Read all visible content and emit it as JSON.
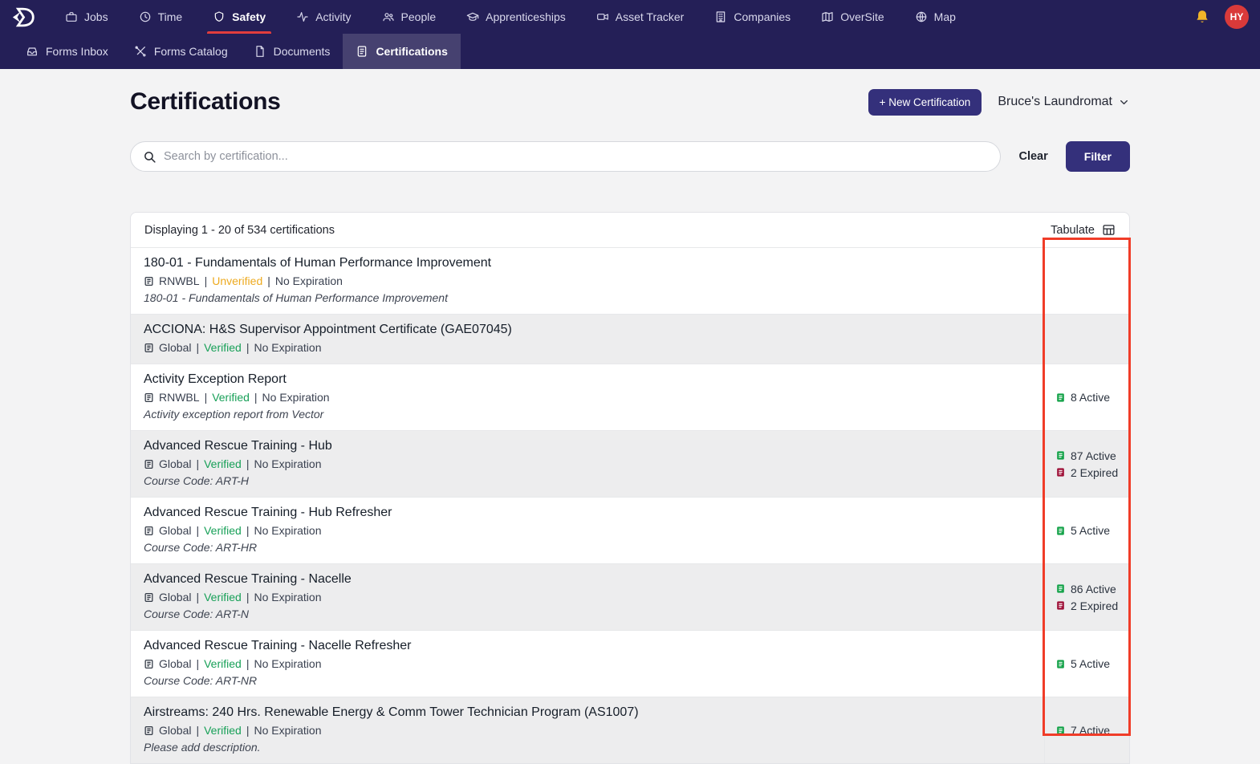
{
  "meta_separator": "|",
  "nav": {
    "avatar": "HY",
    "items": [
      {
        "label": "Jobs"
      },
      {
        "label": "Time"
      },
      {
        "label": "Safety"
      },
      {
        "label": "Activity"
      },
      {
        "label": "People"
      },
      {
        "label": "Apprenticeships"
      },
      {
        "label": "Asset Tracker"
      },
      {
        "label": "Companies"
      },
      {
        "label": "OverSite"
      },
      {
        "label": "Map"
      }
    ]
  },
  "subnav": {
    "items": [
      {
        "label": "Forms Inbox"
      },
      {
        "label": "Forms Catalog"
      },
      {
        "label": "Documents"
      },
      {
        "label": "Certifications"
      }
    ]
  },
  "header": {
    "title": "Certifications",
    "new_button": "+ New Certification",
    "company": "Bruce's Laundromat"
  },
  "search": {
    "placeholder": "Search by certification...",
    "clear": "Clear",
    "filter": "Filter"
  },
  "table": {
    "summary": "Displaying 1 - 20 of 534 certifications",
    "tabulate": "Tabulate",
    "rows": [
      {
        "title": "180-01 - Fundamentals of Human Performance Improvement",
        "scope": "RNWBL",
        "status": "Unverified",
        "expiration": "No Expiration",
        "description": "180-01 - Fundamentals of Human Performance Improvement"
      },
      {
        "title": "ACCIONA: H&S Supervisor Appointment Certificate (GAE07045)",
        "scope": "Global",
        "status": "Verified",
        "expiration": "No Expiration"
      },
      {
        "title": "Activity Exception Report",
        "scope": "RNWBL",
        "status": "Verified",
        "expiration": "No Expiration",
        "description": "Activity exception report from Vector",
        "active": "8 Active"
      },
      {
        "title": "Advanced Rescue Training - Hub",
        "scope": "Global",
        "status": "Verified",
        "expiration": "No Expiration",
        "description": "Course Code: ART-H",
        "active": "87 Active",
        "expired": "2 Expired"
      },
      {
        "title": "Advanced Rescue Training - Hub Refresher",
        "scope": "Global",
        "status": "Verified",
        "expiration": "No Expiration",
        "description": "Course Code: ART-HR",
        "active": "5 Active"
      },
      {
        "title": "Advanced Rescue Training - Nacelle",
        "scope": "Global",
        "status": "Verified",
        "expiration": "No Expiration",
        "description": "Course Code: ART-N",
        "active": "86 Active",
        "expired": "2 Expired"
      },
      {
        "title": "Advanced Rescue Training - Nacelle Refresher",
        "scope": "Global",
        "status": "Verified",
        "expiration": "No Expiration",
        "description": "Course Code: ART-NR",
        "active": "5 Active"
      },
      {
        "title": "Airstreams: 240 Hrs. Renewable Energy & Comm Tower Technician Program (AS1007)",
        "scope": "Global",
        "status": "Verified",
        "expiration": "No Expiration",
        "description": "Please add description.",
        "active": "7 Active"
      }
    ]
  },
  "colors": {
    "navbar": "#241f57",
    "accent_button": "#34307b",
    "active_tab_underline": "#e23d3d",
    "verified": "#18a058",
    "unverified": "#edaa1f",
    "active_count_icon": "#16a34a",
    "expired_count_icon": "#9f1239",
    "annotation_red": "#f03c28"
  }
}
